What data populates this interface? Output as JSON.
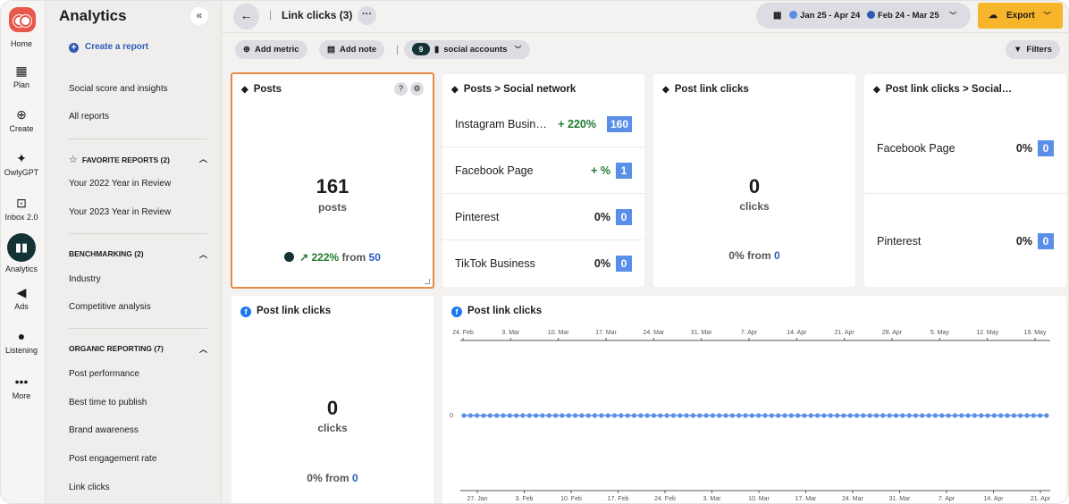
{
  "rail": {
    "items": [
      {
        "label": "Home",
        "icon": "owl-logo-icon"
      },
      {
        "label": "Plan",
        "icon": "calendar-icon"
      },
      {
        "label": "Create",
        "icon": "plus-circle-icon"
      },
      {
        "label": "OwlyGPT",
        "icon": "sparkle-icon"
      },
      {
        "label": "Inbox 2.0",
        "icon": "inbox-icon"
      },
      {
        "label": "Analytics",
        "icon": "bar-chart-icon"
      },
      {
        "label": "Ads",
        "icon": "megaphone-icon"
      },
      {
        "label": "Listening",
        "icon": "lightbulb-icon"
      },
      {
        "label": "More",
        "icon": "ellipsis-icon"
      }
    ]
  },
  "sidebar": {
    "title": "Analytics",
    "create_report": "Create a report",
    "links_top": [
      "Social score and insights",
      "All reports"
    ],
    "favorite_header": "FAVORITE REPORTS (2)",
    "favorites": [
      "Your 2022 Year in Review",
      "Your 2023 Year in Review"
    ],
    "benchmarking_header": "BENCHMARKING (2)",
    "benchmarking": [
      "Industry",
      "Competitive analysis"
    ],
    "organic_header": "ORGANIC REPORTING (7)",
    "organic": [
      "Post performance",
      "Best time to publish",
      "Brand awareness",
      "Post engagement rate",
      "Link clicks"
    ]
  },
  "topbar": {
    "title": "Link clicks (3)",
    "date_range_1": "Jan 25 - Apr 24",
    "date_range_2": "Feb 24 - Mar 25",
    "export_label": "Export"
  },
  "toolbar": {
    "add_metric": "Add metric",
    "add_note": "Add note",
    "accounts_count": "9",
    "accounts_label": "social accounts",
    "filters": "Filters"
  },
  "colors": {
    "accent_blue": "#2f5bb7",
    "compare_blue": "#5a8fe8",
    "export_yellow": "#f6b52a",
    "selected_border": "#e8894a",
    "positive_green": "#1e7a2e"
  },
  "cards": {
    "posts": {
      "title": "Posts",
      "value": "161",
      "unit": "posts",
      "delta": "222%",
      "from_label": "from",
      "from_value": "50"
    },
    "posts_network": {
      "title": "Posts > Social network",
      "rows": [
        {
          "name": "Instagram Busin…",
          "pct": "+ 220%",
          "value": "160"
        },
        {
          "name": "Facebook Page",
          "pct": "+ %",
          "value": "1"
        },
        {
          "name": "Pinterest",
          "pct": "0%",
          "value": "0"
        },
        {
          "name": "TikTok Business",
          "pct": "0%",
          "value": "0"
        }
      ]
    },
    "post_link_clicks": {
      "title": "Post link clicks",
      "value": "0",
      "unit": "clicks",
      "delta": "0%",
      "from_label": "from",
      "from_value": "0"
    },
    "post_link_clicks_social": {
      "title": "Post link clicks > Social…",
      "rows": [
        {
          "name": "Facebook Page",
          "pct": "0%",
          "value": "0"
        },
        {
          "name": "Pinterest",
          "pct": "0%",
          "value": "0"
        }
      ]
    },
    "fb_link_clicks": {
      "title": "Post link clicks",
      "value": "0",
      "unit": "clicks",
      "delta": "0%",
      "from_label": "from",
      "from_value": "0"
    },
    "fb_chart_title": "Post link clicks"
  },
  "chart_data": {
    "type": "line",
    "title": "Post link clicks",
    "top_axis_ticks": [
      "24. Feb",
      "3. Mar",
      "10. Mar",
      "17. Mar",
      "24. Mar",
      "31. Mar",
      "7. Apr",
      "14. Apr",
      "21. Apr",
      "28. Apr",
      "5. May",
      "12. May",
      "19. May"
    ],
    "bottom_axis_ticks": [
      "27. Jan",
      "3. Feb",
      "10. Feb",
      "17. Feb",
      "24. Feb",
      "3. Mar",
      "10. Mar",
      "17. Mar",
      "24. Mar",
      "31. Mar",
      "7. Apr",
      "14. Apr",
      "21. Apr"
    ],
    "y_ticks": [
      "0"
    ],
    "series": [
      {
        "color": "#5a8fe8",
        "values": [
          0,
          0,
          0,
          0,
          0,
          0,
          0,
          0,
          0,
          0,
          0,
          0,
          0,
          0,
          0,
          0,
          0,
          0,
          0,
          0,
          0,
          0,
          0,
          0,
          0,
          0,
          0,
          0,
          0,
          0,
          0,
          0,
          0,
          0,
          0,
          0,
          0,
          0,
          0,
          0,
          0,
          0,
          0,
          0,
          0,
          0,
          0,
          0,
          0,
          0,
          0,
          0,
          0,
          0,
          0,
          0,
          0,
          0,
          0,
          0,
          0,
          0,
          0,
          0,
          0,
          0,
          0,
          0,
          0,
          0,
          0,
          0,
          0,
          0,
          0,
          0,
          0,
          0,
          0,
          0,
          0,
          0,
          0,
          0,
          0,
          0,
          0,
          0,
          0,
          0
        ]
      }
    ],
    "ylim": [
      0,
      1
    ],
    "grid": false
  }
}
